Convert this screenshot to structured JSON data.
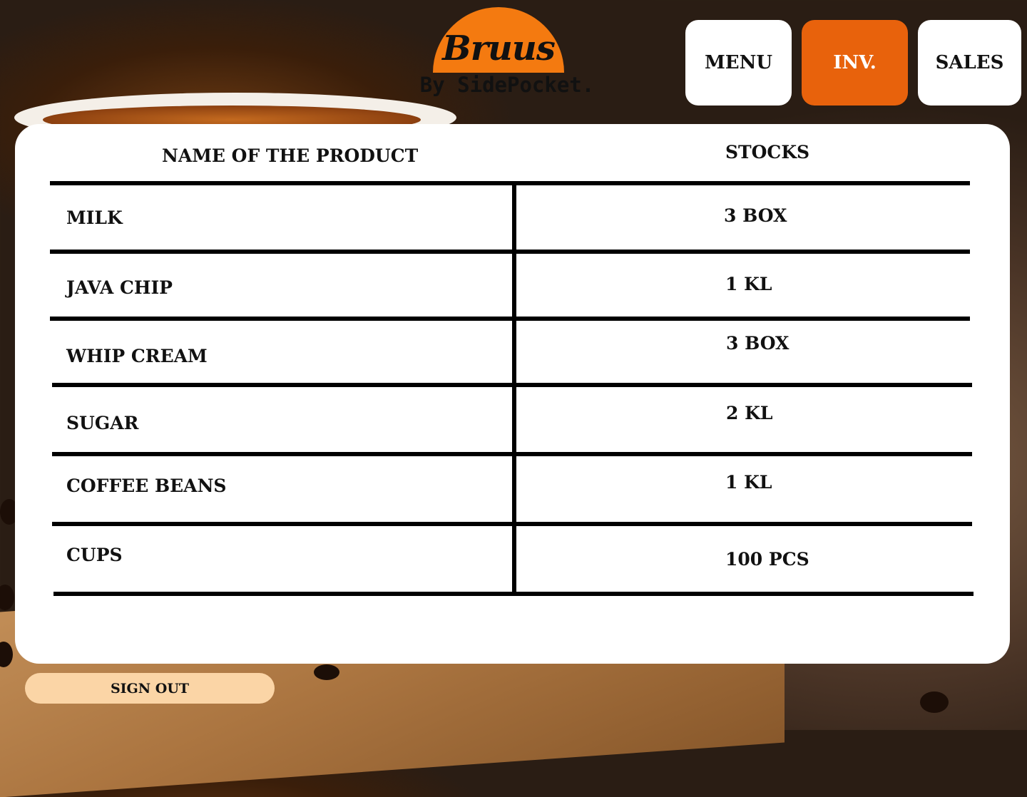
{
  "brand": {
    "name": "Bruus",
    "tagline": "By SidePocket."
  },
  "nav": {
    "items": [
      {
        "label": "MENU",
        "active": false
      },
      {
        "label": "INV.",
        "active": true
      },
      {
        "label": "SALES",
        "active": false
      }
    ]
  },
  "inventory": {
    "columns": [
      "NAME OF THE PRODUCT",
      "STOCKS"
    ],
    "rows": [
      {
        "product": "MILK",
        "stock": "3 BOX"
      },
      {
        "product": "JAVA CHIP",
        "stock": "1 KL"
      },
      {
        "product": "WHIP CREAM",
        "stock": "3 BOX"
      },
      {
        "product": "SUGAR",
        "stock": "2 KL"
      },
      {
        "product": "COFFEE BEANS",
        "stock": "1 KL"
      },
      {
        "product": "CUPS",
        "stock": "100 PCS"
      }
    ]
  },
  "footer": {
    "signout_label": "SIGN OUT"
  },
  "colors": {
    "accent": "#e8620c",
    "logo": "#f47a10",
    "signout_bg": "#fbd5a6"
  }
}
